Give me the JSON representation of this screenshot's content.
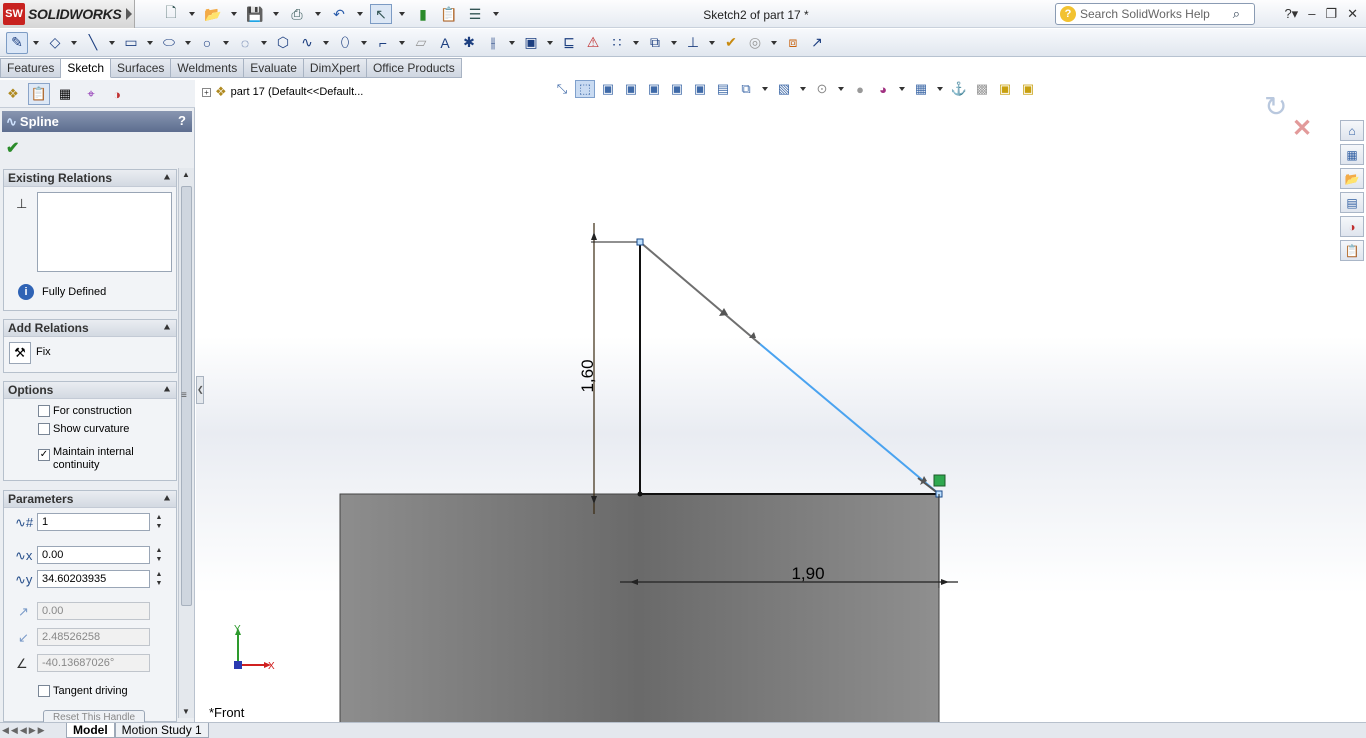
{
  "app": {
    "brand": "SOLIDWORKS",
    "brand_badge": "SW",
    "document_title": "Sketch2 of part 17 *"
  },
  "help_search": {
    "placeholder": "Search SolidWorks Help"
  },
  "tabs": [
    "Features",
    "Sketch",
    "Surfaces",
    "Weldments",
    "Evaluate",
    "DimXpert",
    "Office Products"
  ],
  "active_tab": "Sketch",
  "property_manager": {
    "title": "Spline",
    "help": "?",
    "existing_relations": {
      "title": "Existing Relations",
      "status": "Fully Defined"
    },
    "add_relations": {
      "title": "Add Relations",
      "items": [
        "Fix"
      ]
    },
    "options": {
      "title": "Options",
      "for_construction": {
        "label": "For construction",
        "checked": false
      },
      "show_curvature": {
        "label": "Show curvature",
        "checked": false
      },
      "maintain_continuity": {
        "label_line1": "Maintain internal",
        "label_line2": "continuity",
        "checked": true
      }
    },
    "parameters": {
      "title": "Parameters",
      "point_number": "1",
      "x": "0.00",
      "y": "34.60203935",
      "tangent_weight_1": "0.00",
      "tangent_weight_2": "2.48526258",
      "tangent_angle": "-40.13687026°",
      "tangent_driving": {
        "label": "Tangent driving",
        "checked": false
      },
      "reset_button": "Reset This Handle"
    }
  },
  "feature_tree": {
    "root": "part 17  (Default<<Default..."
  },
  "graphics": {
    "dimension_vertical": "1,60",
    "dimension_horizontal": "1,90",
    "view_name": "*Front",
    "triad_x": "X",
    "triad_y": "Y",
    "spline_color": "#4aa3f0",
    "part_fill": "#808080"
  },
  "bottom_tabs": [
    "Model",
    "Motion Study 1"
  ],
  "active_bottom_tab": "Model"
}
